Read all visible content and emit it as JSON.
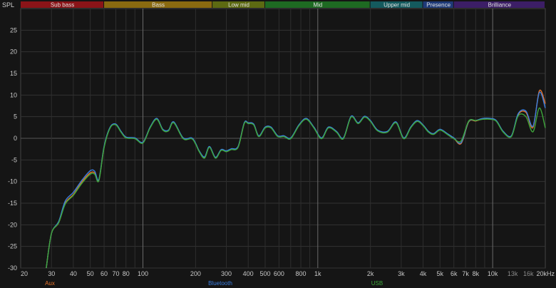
{
  "chart_data": {
    "type": "line",
    "ylabel": "SPL",
    "xscale": "log",
    "xlim": [
      20,
      20000
    ],
    "ylim": [
      -30,
      30
    ],
    "grid": true,
    "bands": [
      {
        "label": "Sub bass",
        "from": 20,
        "to": 60,
        "color": "#8a1418"
      },
      {
        "label": "Bass",
        "from": 60,
        "to": 250,
        "color": "#8a6a10"
      },
      {
        "label": "Low mid",
        "from": 250,
        "to": 500,
        "color": "#5d6a12"
      },
      {
        "label": "Mid",
        "from": 500,
        "to": 2000,
        "color": "#1e6a22"
      },
      {
        "label": "Upper mid",
        "from": 2000,
        "to": 4000,
        "color": "#145a5e"
      },
      {
        "label": "Presence",
        "from": 4000,
        "to": 6000,
        "color": "#1e3a78"
      },
      {
        "label": "Brilliance",
        "from": 6000,
        "to": 20000,
        "color": "#3c1e66"
      }
    ],
    "y_ticks": [
      25,
      20,
      15,
      10,
      5,
      0,
      -5,
      -10,
      -15,
      -20,
      -25,
      -30
    ],
    "x_ticks": [
      {
        "v": 20,
        "t": "20"
      },
      {
        "v": 30,
        "t": "30"
      },
      {
        "v": 40,
        "t": "40"
      },
      {
        "v": 50,
        "t": "50"
      },
      {
        "v": 60,
        "t": "60"
      },
      {
        "v": 70,
        "t": "70"
      },
      {
        "v": 80,
        "t": "80"
      },
      {
        "v": 100,
        "t": "100"
      },
      {
        "v": 200,
        "t": "200"
      },
      {
        "v": 300,
        "t": "300"
      },
      {
        "v": 400,
        "t": "400"
      },
      {
        "v": 500,
        "t": "500"
      },
      {
        "v": 600,
        "t": "600"
      },
      {
        "v": 800,
        "t": "800"
      },
      {
        "v": 1000,
        "t": "1k"
      },
      {
        "v": 2000,
        "t": "2k"
      },
      {
        "v": 3000,
        "t": "3k"
      },
      {
        "v": 4000,
        "t": "4k"
      },
      {
        "v": 5000,
        "t": "5k"
      },
      {
        "v": 6000,
        "t": "6k"
      },
      {
        "v": 7000,
        "t": "7k"
      },
      {
        "v": 8000,
        "t": "8k"
      },
      {
        "v": 10000,
        "t": "10k"
      },
      {
        "v": 13000,
        "t": "13k"
      },
      {
        "v": 16000,
        "t": "16k"
      },
      {
        "v": 20000,
        "t": "20kHz"
      }
    ],
    "x": [
      28,
      30,
      33,
      36,
      40,
      45,
      50,
      53,
      56,
      60,
      65,
      70,
      75,
      80,
      90,
      100,
      110,
      120,
      130,
      140,
      150,
      170,
      190,
      200,
      210,
      225,
      240,
      260,
      280,
      300,
      320,
      350,
      380,
      400,
      430,
      460,
      500,
      540,
      590,
      640,
      700,
      780,
      860,
      950,
      1050,
      1150,
      1280,
      1400,
      1550,
      1700,
      1850,
      2000,
      2200,
      2500,
      2800,
      3100,
      3400,
      3700,
      4000,
      4300,
      4600,
      5000,
      5500,
      6000,
      6600,
      7300,
      8000,
      8800,
      9700,
      10500,
      11500,
      12800,
      14000,
      15500,
      17000,
      18500,
      20000
    ],
    "series": [
      {
        "name": "Aux",
        "color": "#e8732a",
        "values": [
          -30,
          -22,
          -19.5,
          -15,
          -13,
          -10,
          -8,
          -8,
          -9.6,
          -2,
          2.5,
          3.2,
          1.5,
          0.2,
          0,
          -1,
          2.5,
          4.5,
          2,
          1.8,
          3.7,
          0,
          0,
          -1.2,
          -3,
          -4.5,
          -2,
          -4.5,
          -2.7,
          -3,
          -2.5,
          -2,
          3.5,
          3.5,
          3.2,
          0.5,
          2.5,
          2.5,
          0.5,
          0.5,
          0,
          3,
          4.5,
          2.5,
          0,
          2.5,
          1.5,
          0,
          5,
          3.5,
          5,
          4,
          1.8,
          1.5,
          3.7,
          0,
          2.5,
          4,
          3,
          1.5,
          1,
          2,
          1,
          0,
          -1.2,
          3.8,
          4,
          4.5,
          4.5,
          4,
          1.5,
          0.5,
          5.5,
          6,
          2.5,
          11,
          8
        ]
      },
      {
        "name": "Bluetooth",
        "color": "#3a7ee0",
        "values": [
          -30,
          -22,
          -19.2,
          -14.5,
          -12.5,
          -9.6,
          -7.5,
          -7.6,
          -9.5,
          -1.8,
          2.6,
          3.3,
          1.6,
          0.3,
          0.1,
          -0.9,
          2.6,
          4.6,
          2.1,
          1.9,
          3.8,
          0.1,
          0.1,
          -1.1,
          -2.9,
          -4.3,
          -1.9,
          -4.4,
          -2.6,
          -2.9,
          -2.4,
          -1.9,
          3.6,
          3.6,
          3.3,
          0.6,
          2.6,
          2.6,
          0.6,
          0.6,
          0.1,
          3.1,
          4.6,
          2.6,
          0.1,
          2.6,
          1.6,
          0.1,
          5.1,
          3.6,
          5.1,
          4.1,
          1.9,
          1.6,
          3.8,
          0.1,
          2.6,
          4.1,
          3.1,
          1.6,
          1.1,
          2.1,
          1.1,
          0.1,
          -1,
          3.9,
          4.1,
          4.6,
          4.6,
          4.1,
          1.6,
          0.6,
          5.7,
          6.3,
          2.8,
          10.6,
          7
        ]
      },
      {
        "name": "USB",
        "color": "#3da63a",
        "values": [
          -30,
          -22,
          -19.5,
          -15.2,
          -13.2,
          -10.3,
          -8.3,
          -8.3,
          -9.8,
          -2.1,
          2.4,
          3.1,
          1.4,
          0.1,
          -0.1,
          -1.1,
          2.4,
          4.4,
          1.9,
          1.7,
          3.6,
          -0.1,
          -0.1,
          -1.3,
          -3.1,
          -4.6,
          -2.1,
          -4.6,
          -2.8,
          -3.1,
          -2.6,
          -2.1,
          3.4,
          3.4,
          3.1,
          0.4,
          2.4,
          2.4,
          0.4,
          0.4,
          -0.1,
          2.9,
          4.4,
          2.4,
          -0.1,
          2.4,
          1.4,
          -0.1,
          4.9,
          3.4,
          4.9,
          3.9,
          1.7,
          1.4,
          3.6,
          -0.1,
          2.4,
          3.9,
          2.9,
          1.4,
          0.9,
          1.9,
          0.9,
          -0.1,
          -0.6,
          4,
          4.1,
          4.4,
          4.4,
          3.9,
          1.4,
          0.4,
          5.2,
          5,
          1.5,
          7,
          2.4
        ]
      }
    ]
  }
}
